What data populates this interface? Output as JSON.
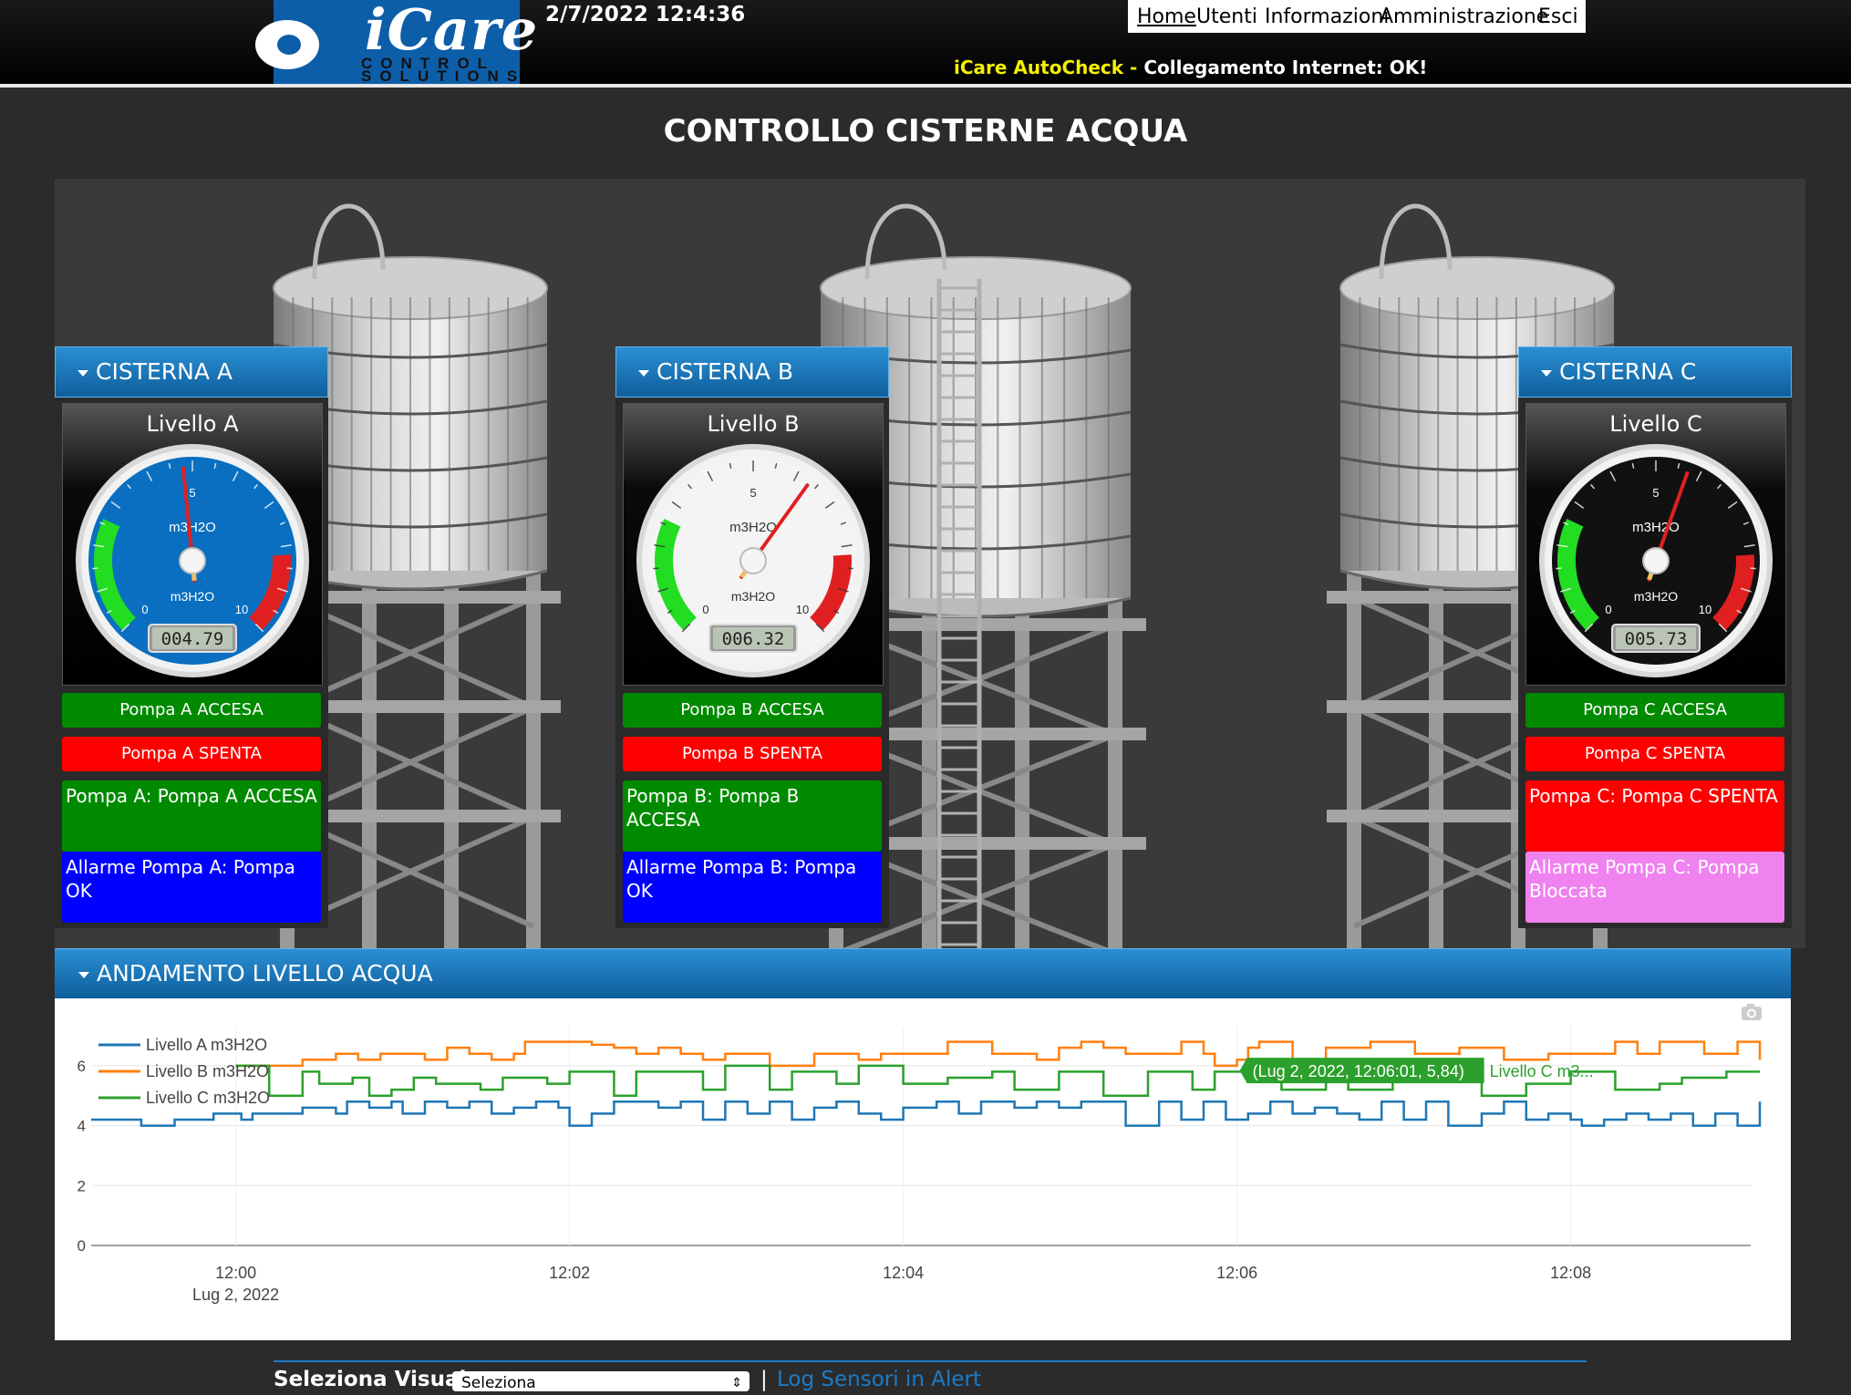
{
  "header": {
    "logo_text": "iCare",
    "logo_sub1": "CONTROL",
    "logo_sub2": "SOLUTIONS",
    "datetime": "2/7/2022 12:4:36",
    "nav": [
      "Home",
      "Utenti",
      "Informazioni",
      "Amministrazione",
      "Esci"
    ],
    "status_label": "iCare AutoCheck - ",
    "status_text": "Collegamento Internet: OK!"
  },
  "page_title": "CONTROLLO CISTERNE ACQUA",
  "tanks": [
    {
      "header": "CISTERNA A",
      "gauge_title": "Livello A",
      "unit": "m3H2O",
      "scale_min": "0",
      "scale_mid": "5",
      "scale_max": "10",
      "value": 4.79,
      "display": "004.79",
      "dial_color": "#0a6fc0",
      "pump_on": "Pompa A ACCESA",
      "pump_off": "Pompa A SPENTA",
      "state_text": "Pompa A: Pompa A ACCESA",
      "alarm_text": "Allarme Pompa A: Pompa OK"
    },
    {
      "header": "CISTERNA B",
      "gauge_title": "Livello B",
      "unit": "m3H2O",
      "scale_min": "0",
      "scale_mid": "5",
      "scale_max": "10",
      "value": 6.32,
      "display": "006.32",
      "dial_color": "#f4f4f4",
      "pump_on": "Pompa B ACCESA",
      "pump_off": "Pompa B SPENTA",
      "state_text": "Pompa B: Pompa B ACCESA",
      "alarm_text": "Allarme Pompa B: Pompa OK"
    },
    {
      "header": "CISTERNA C",
      "gauge_title": "Livello C",
      "unit": "m3H2O",
      "scale_min": "0",
      "scale_mid": "5",
      "scale_max": "10",
      "value": 5.73,
      "display": "005.73",
      "dial_color": "#111111",
      "pump_on": "Pompa C ACCESA",
      "pump_off": "Pompa C SPENTA",
      "state_text": "Pompa C: Pompa C SPENTA",
      "alarm_text": "Allarme Pompa C: Pompa Bloccata"
    }
  ],
  "chart_panel": {
    "header": "ANDAMENTO LIVELLO ACQUA",
    "camera_icon": "camera-icon",
    "tooltip": "(Lug 2, 2022, 12:06:01, 5,84)",
    "tooltip_series": "Livello C m3..."
  },
  "chart_data": {
    "type": "line",
    "x_ticks": [
      "12:00",
      "12:02",
      "12:04",
      "12:06",
      "12:08"
    ],
    "x_tick_values": [
      0,
      120,
      240,
      360,
      480
    ],
    "x_sublabel": "Lug 2, 2022",
    "xlim": [
      -52,
      548
    ],
    "ylim": [
      0,
      7
    ],
    "y_ticks": [
      0,
      2,
      4,
      6
    ],
    "legend_position": "top-left",
    "series": [
      {
        "name": "Livello A m3H2O",
        "color": "#1f77b4",
        "x": [
          -52,
          -40,
          -34,
          -28,
          -22,
          -14,
          -8,
          -2,
          2,
          4,
          6,
          8,
          12,
          16,
          20,
          24,
          30,
          36,
          40,
          44,
          48,
          52,
          56,
          60,
          64,
          68,
          72,
          76,
          80,
          84,
          88,
          92,
          96,
          100,
          104,
          108,
          112,
          116,
          120,
          124,
          128,
          132,
          136,
          140,
          144,
          148,
          152,
          156,
          160,
          164,
          168,
          172,
          176,
          180,
          184,
          188,
          192,
          196,
          200,
          204,
          208,
          212,
          216,
          220,
          224,
          228,
          232,
          236,
          240,
          244,
          248,
          252,
          256,
          260,
          264,
          268,
          272,
          276,
          280,
          284,
          288,
          292,
          296,
          300,
          304,
          308,
          312,
          316,
          320,
          324,
          328,
          332,
          336,
          340,
          344,
          348,
          352,
          356,
          360,
          364,
          368,
          372,
          376,
          380,
          384,
          388,
          392,
          396,
          400,
          404,
          408,
          412,
          416,
          420,
          424,
          428,
          432,
          436,
          440,
          444,
          448,
          452,
          456,
          460,
          464,
          468,
          472,
          476,
          480,
          484,
          488,
          492,
          496,
          500,
          504,
          508,
          512,
          516,
          520,
          524,
          528,
          532,
          536,
          540,
          544,
          548
        ],
        "y": [
          4.2,
          4.2,
          4.0,
          4.0,
          4.2,
          4.2,
          4.4,
          4.4,
          4.2,
          4.2,
          4.4,
          4.4,
          4.4,
          4.4,
          4.4,
          4.6,
          4.6,
          4.4,
          4.8,
          4.8,
          4.6,
          4.6,
          4.8,
          4.4,
          4.4,
          4.8,
          4.8,
          4.6,
          4.6,
          4.8,
          4.8,
          4.4,
          4.4,
          4.6,
          4.6,
          4.8,
          4.8,
          4.6,
          4.0,
          4.0,
          4.4,
          4.4,
          4.8,
          4.8,
          4.8,
          4.8,
          4.6,
          4.6,
          4.8,
          4.8,
          4.2,
          4.2,
          4.8,
          4.8,
          4.4,
          4.4,
          4.8,
          4.8,
          4.2,
          4.2,
          4.6,
          4.6,
          4.8,
          4.8,
          4.4,
          4.4,
          4.2,
          4.2,
          4.6,
          4.6,
          4.6,
          4.8,
          4.8,
          4.4,
          4.4,
          4.8,
          4.8,
          4.8,
          4.6,
          4.6,
          4.8,
          4.8,
          4.6,
          4.6,
          4.8,
          4.8,
          4.8,
          4.8,
          4.0,
          4.0,
          4.0,
          4.8,
          4.8,
          4.2,
          4.2,
          4.8,
          4.8,
          4.2,
          4.2,
          4.4,
          4.4,
          4.8,
          4.8,
          4.4,
          4.4,
          4.6,
          4.6,
          4.4,
          4.4,
          4.2,
          4.2,
          4.8,
          4.8,
          4.2,
          4.2,
          4.8,
          4.8,
          4.0,
          4.0,
          4.0,
          4.4,
          4.4,
          4.8,
          4.8,
          4.2,
          4.2,
          4.4,
          4.4,
          4.2,
          4.0,
          4.0,
          4.2,
          4.2,
          4.4,
          4.4,
          4.2,
          4.2,
          4.4,
          4.4,
          4.0,
          4.0,
          4.4,
          4.4,
          4.0,
          4.0,
          4.8
        ]
      },
      {
        "name": "Livello B m3H2O",
        "color": "#ff7f0e",
        "x": [
          0,
          20,
          24,
          28,
          36,
          44,
          52,
          60,
          68,
          76,
          84,
          92,
          100,
          104,
          108,
          116,
          120,
          128,
          136,
          144,
          152,
          160,
          168,
          176,
          184,
          192,
          200,
          208,
          216,
          224,
          232,
          240,
          248,
          256,
          264,
          272,
          280,
          288,
          296,
          304,
          312,
          320,
          328,
          336,
          340,
          344,
          348,
          352,
          356,
          360,
          364,
          368,
          376,
          380,
          384,
          392,
          400,
          408,
          416,
          424,
          432,
          440,
          448,
          456,
          464,
          472,
          480,
          488,
          496,
          500,
          504,
          508,
          512,
          520,
          528,
          536,
          540,
          548
        ],
        "y": [
          6.0,
          6.0,
          6.2,
          6.2,
          6.4,
          6.2,
          6.4,
          6.4,
          6.2,
          6.6,
          6.4,
          6.2,
          6.4,
          6.8,
          6.8,
          6.8,
          6.8,
          6.7,
          6.6,
          6.4,
          6.6,
          6.4,
          6.2,
          6.4,
          6.4,
          6.0,
          6.0,
          6.4,
          6.4,
          6.2,
          6.4,
          6.4,
          6.4,
          6.8,
          6.8,
          6.4,
          6.4,
          6.2,
          6.6,
          6.8,
          6.6,
          6.4,
          6.4,
          6.4,
          6.8,
          6.8,
          6.4,
          6.0,
          6.0,
          6.2,
          6.6,
          6.8,
          6.8,
          6.2,
          6.2,
          6.6,
          6.6,
          6.8,
          6.8,
          6.4,
          6.4,
          6.6,
          6.6,
          6.2,
          6.2,
          6.4,
          6.4,
          6.4,
          6.8,
          6.8,
          6.4,
          6.4,
          6.8,
          6.8,
          6.4,
          6.4,
          6.8,
          6.2
        ]
      },
      {
        "name": "Livello C m3H2O",
        "color": "#2ca02c",
        "x": [
          0,
          6,
          12,
          18,
          24,
          30,
          36,
          42,
          48,
          56,
          64,
          72,
          80,
          88,
          96,
          104,
          112,
          120,
          128,
          136,
          144,
          152,
          160,
          168,
          176,
          184,
          192,
          200,
          208,
          216,
          224,
          232,
          240,
          248,
          256,
          264,
          272,
          280,
          288,
          296,
          304,
          312,
          320,
          328,
          336,
          344,
          352,
          360,
          368,
          376,
          384,
          392,
          400,
          408,
          416,
          424,
          432,
          440,
          448,
          456,
          464,
          472,
          480,
          488,
          496,
          504,
          512,
          520,
          528,
          536,
          548
        ],
        "y": [
          6.0,
          6.0,
          5.0,
          5.0,
          5.8,
          5.4,
          5.4,
          5.6,
          5.0,
          5.2,
          5.6,
          5.4,
          5.4,
          5.2,
          5.6,
          5.6,
          5.4,
          5.8,
          5.8,
          5.0,
          5.8,
          5.8,
          5.8,
          5.2,
          6.0,
          6.0,
          5.2,
          5.8,
          5.8,
          5.4,
          6.0,
          6.0,
          5.4,
          5.4,
          5.6,
          5.6,
          5.8,
          5.2,
          5.2,
          5.8,
          5.8,
          5.0,
          5.0,
          5.8,
          5.8,
          5.2,
          5.8,
          5.8,
          5.8,
          5.2,
          5.2,
          5.8,
          5.2,
          5.2,
          5.6,
          5.6,
          5.8,
          5.8,
          5.0,
          5.0,
          5.4,
          5.4,
          5.8,
          5.8,
          5.2,
          5.2,
          5.4,
          5.6,
          5.6,
          5.8,
          5.8
        ]
      }
    ]
  },
  "footer": {
    "select_label": "Seleziona Visuale:",
    "select_value": "Seleziona",
    "separator": "|",
    "log_link": "Log Sensori in Alert"
  }
}
